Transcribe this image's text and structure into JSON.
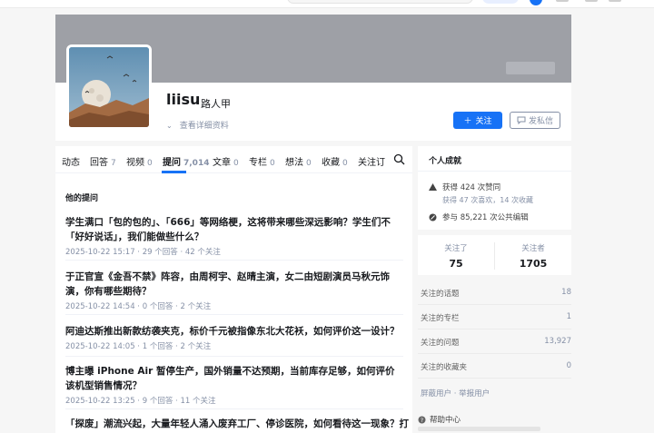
{
  "profile": {
    "name": "liisu",
    "headline": "路人甲",
    "detail_link": "查看详细资料",
    "follow_button": "关注",
    "message_button": "发私信"
  },
  "tabs": [
    {
      "label": "动态",
      "count": ""
    },
    {
      "label": "回答",
      "count": "7"
    },
    {
      "label": "视频",
      "count": "0"
    },
    {
      "label": "提问",
      "count": "7,014"
    },
    {
      "label": "文章",
      "count": "0"
    },
    {
      "label": "专栏",
      "count": "0"
    },
    {
      "label": "想法",
      "count": "0"
    },
    {
      "label": "收藏",
      "count": "0"
    },
    {
      "label": "关注订",
      "count": ""
    }
  ],
  "questions_section": {
    "title": "他的提问",
    "items": [
      {
        "title": "学生满口「包的包的」、「666」等网络梗，这将带来哪些深远影响？学生们不「好好说话」，我们能做些什么？",
        "date": "2025-10-22 15:17",
        "answers": "29 个回答",
        "followers": "42 个关注"
      },
      {
        "title": "于正官宣《金吾不禁》阵容，由周柯宇、赵晴主演，女二由短剧演员马秋元饰演，你有哪些期待？",
        "date": "2025-10-22 14:54",
        "answers": "0 个回答",
        "followers": "2 个关注"
      },
      {
        "title": "阿迪达斯推出新款纺袭夹克，标价千元被指像东北大花袄，如何评价这一设计？",
        "date": "2025-10-22 14:05",
        "answers": "1 个回答",
        "followers": "2 个关注"
      },
      {
        "title": "博主曝 iPhone Air 暂停生产，国外销量不达预期，当前库存足够，如何评价该机型销售情况？",
        "date": "2025-10-22 13:25",
        "answers": "9 个回答",
        "followers": "11 个关注"
      },
      {
        "title": "「探废」潮流兴起，大量年轻人涌入废弃工厂、停诊医院，如何看待这一现象？打",
        "date": "",
        "answers": "",
        "followers": ""
      }
    ]
  },
  "achievements": {
    "title": "个人成就",
    "likes": "获得 424 次赞同",
    "likes_detail": "获得 47 次喜欢，14 次收藏",
    "edits": "参与 85,221 次公共编辑"
  },
  "stats": {
    "following_label": "关注了",
    "following_value": "75",
    "followers_label": "关注者",
    "followers_value": "1705"
  },
  "follow_links": [
    {
      "label": "关注的话题",
      "value": "18"
    },
    {
      "label": "关注的专栏",
      "value": "1"
    },
    {
      "label": "关注的问题",
      "value": "13,927"
    },
    {
      "label": "关注的收藏夹",
      "value": "0"
    }
  ],
  "footer": {
    "links": "屏蔽用户 · 举报用户",
    "help": "帮助中心"
  },
  "colors": {
    "accent": "#1772f6",
    "cover": "#9ea0a6",
    "muted": "#8590a6"
  }
}
